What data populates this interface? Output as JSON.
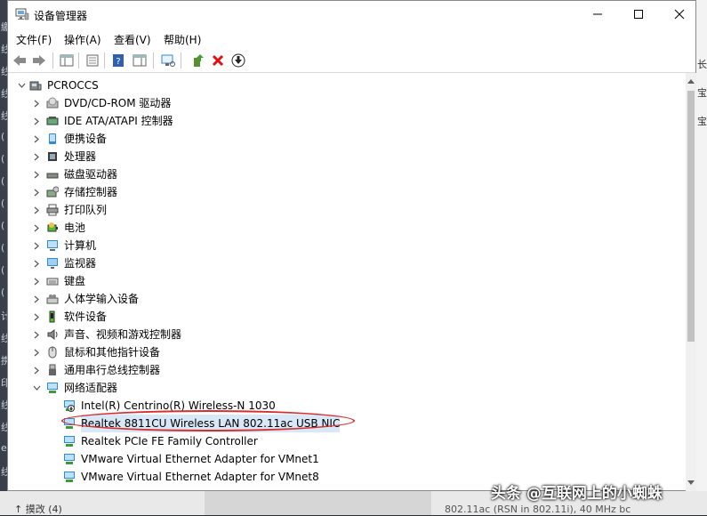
{
  "window": {
    "title": "设备管理器"
  },
  "menu": [
    {
      "label": "文件(F)"
    },
    {
      "label": "操作(A)"
    },
    {
      "label": "查看(V)"
    },
    {
      "label": "帮助(H)"
    }
  ],
  "tree": {
    "root": "PCROCCS",
    "categories": [
      {
        "label": "DVD/CD-ROM 驱动器",
        "icon": "dvd-drive-icon"
      },
      {
        "label": "IDE ATA/ATAPI 控制器",
        "icon": "ide-controller-icon"
      },
      {
        "label": "便携设备",
        "icon": "portable-device-icon"
      },
      {
        "label": "处理器",
        "icon": "processor-icon"
      },
      {
        "label": "磁盘驱动器",
        "icon": "disk-drive-icon"
      },
      {
        "label": "存储控制器",
        "icon": "storage-controller-icon"
      },
      {
        "label": "打印队列",
        "icon": "printer-icon"
      },
      {
        "label": "电池",
        "icon": "battery-icon"
      },
      {
        "label": "计算机",
        "icon": "computer-icon"
      },
      {
        "label": "监视器",
        "icon": "monitor-icon"
      },
      {
        "label": "键盘",
        "icon": "keyboard-icon"
      },
      {
        "label": "人体学输入设备",
        "icon": "hid-icon"
      },
      {
        "label": "软件设备",
        "icon": "software-device-icon"
      },
      {
        "label": "声音、视频和游戏控制器",
        "icon": "sound-icon"
      },
      {
        "label": "鼠标和其他指针设备",
        "icon": "mouse-icon"
      },
      {
        "label": "通用串行总线控制器",
        "icon": "usb-icon"
      },
      {
        "label": "网络适配器",
        "icon": "network-adapter-icon",
        "expanded": true
      }
    ],
    "network_adapters": [
      {
        "label": "Intel(R) Centrino(R) Wireless-N 1030",
        "disabled": true
      },
      {
        "label": "Realtek 8811CU Wireless LAN 802.11ac USB NIC",
        "selected": true
      },
      {
        "label": "Realtek PCIe FE Family Controller"
      },
      {
        "label": "VMware Virtual Ethernet Adapter for VMnet1"
      },
      {
        "label": "VMware Virtual Ethernet Adapter for VMnet8"
      }
    ]
  },
  "background": {
    "left_chars": [
      "繳",
      "线",
      "线",
      "线",
      "线",
      "(",
      "(",
      "(",
      "(",
      "(",
      "(",
      "(",
      "(",
      "计",
      "线",
      "携",
      "印",
      "线",
      "线",
      "e",
      "线"
    ],
    "right_chars": [
      "长",
      "宝",
      "宝"
    ],
    "bottom_left": "↑ 摸改 (4)",
    "bottom_right": "802.11ac (RSN in 802.11i), 40 MHz bc"
  },
  "watermark": "头条 @互联网上的小蜘蛛",
  "colors": {
    "highlight": "#d62f2f",
    "selection": "#d9e8f7",
    "accent": "#2f8ad8"
  }
}
